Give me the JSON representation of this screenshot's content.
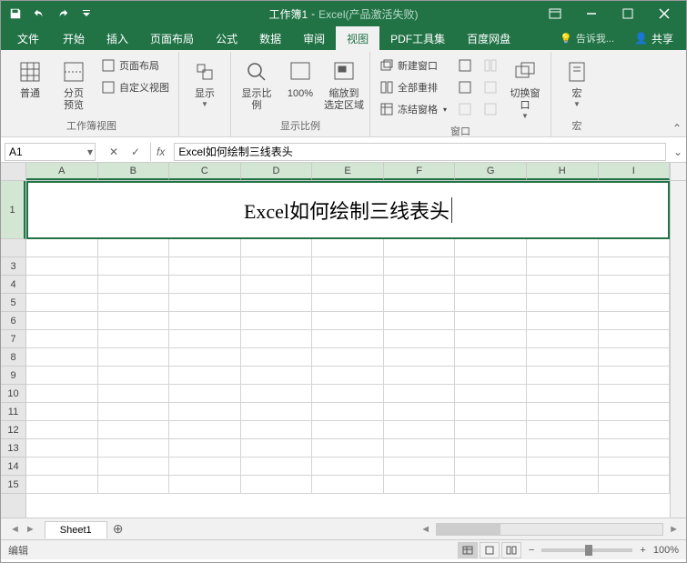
{
  "titlebar": {
    "doc_name": "工作簿1",
    "app_suffix": "Excel(产品激活失败)",
    "separator": " - "
  },
  "tabs": {
    "file": "文件",
    "home": "开始",
    "insert": "插入",
    "page_layout": "页面布局",
    "formulas": "公式",
    "data": "数据",
    "review": "审阅",
    "view": "视图",
    "pdf": "PDF工具集",
    "baidu": "百度网盘",
    "tell_me": "告诉我...",
    "share": "共享"
  },
  "ribbon": {
    "workbook_views": {
      "normal": "普通",
      "page_break": "分页\n预览",
      "page_layout": "页面布局",
      "custom_views": "自定义视图",
      "group": "工作簿视图"
    },
    "show": {
      "label": "显示",
      "group": ""
    },
    "zoom": {
      "zoom": "显示比例",
      "to100": "100%",
      "to_selection": "缩放到\n选定区域",
      "group": "显示比例"
    },
    "window": {
      "new_window": "新建窗口",
      "arrange_all": "全部重排",
      "freeze": "冻结窗格",
      "switch": "切换窗口",
      "group": "窗口"
    },
    "macros": {
      "label": "宏",
      "group": "宏"
    }
  },
  "formula_bar": {
    "name_box": "A1",
    "formula": "Excel如何绘制三线表头"
  },
  "grid": {
    "columns": [
      "A",
      "B",
      "C",
      "D",
      "E",
      "F",
      "G",
      "H",
      "I"
    ],
    "rows": [
      "1",
      "",
      "3",
      "4",
      "5",
      "6",
      "7",
      "8",
      "9",
      "10",
      "11",
      "12",
      "13",
      "14",
      "15"
    ],
    "merged_text": "Excel如何绘制三线表头"
  },
  "sheet_tabs": {
    "sheet1": "Sheet1"
  },
  "statusbar": {
    "mode": "编辑",
    "zoom": "100%"
  }
}
